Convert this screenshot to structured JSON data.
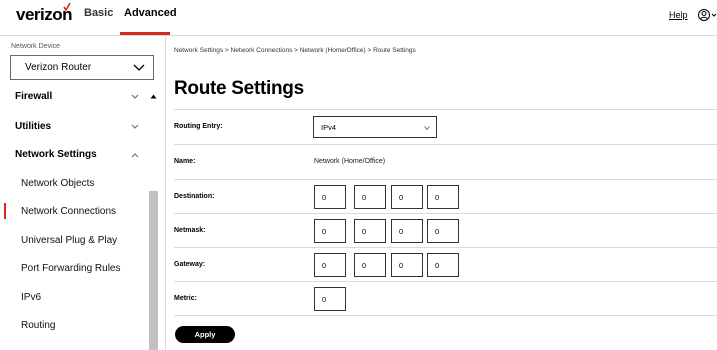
{
  "header": {
    "logo_text": "verizon",
    "tabs": [
      "Basic",
      "Advanced"
    ],
    "active_tab": "Advanced",
    "help_label": "Help",
    "accent_color": "#d52b1e"
  },
  "sidebar": {
    "device_label": "Network Device",
    "device_value": "Verizon Router",
    "items": [
      {
        "label": "Firewall",
        "type": "section",
        "expanded": false
      },
      {
        "label": "Utilities",
        "type": "section",
        "expanded": false
      },
      {
        "label": "Network Settings",
        "type": "section",
        "expanded": true
      },
      {
        "label": "Network Objects",
        "type": "sub"
      },
      {
        "label": "Network Connections",
        "type": "sub",
        "active": true
      },
      {
        "label": "Universal Plug & Play",
        "type": "sub"
      },
      {
        "label": "Port Forwarding Rules",
        "type": "sub"
      },
      {
        "label": "IPv6",
        "type": "sub"
      },
      {
        "label": "Routing",
        "type": "sub"
      }
    ]
  },
  "breadcrumb": "Network Settings  >  Network Connections  >  Network (Home/Office)  >  Route Settings",
  "page_title": "Route Settings",
  "form": {
    "routing_entry_label": "Routing Entry:",
    "routing_entry_value": "IPv4",
    "name_label": "Name:",
    "name_value": "Network (Home/Office)",
    "destination_label": "Destination:",
    "destination": [
      "0",
      "0",
      "0",
      "0"
    ],
    "netmask_label": "Netmask:",
    "netmask": [
      "0",
      "0",
      "0",
      "0"
    ],
    "gateway_label": "Gateway:",
    "gateway": [
      "0",
      "0",
      "0",
      "0"
    ],
    "metric_label": "Metric:",
    "metric": "0",
    "apply_label": "Apply"
  }
}
